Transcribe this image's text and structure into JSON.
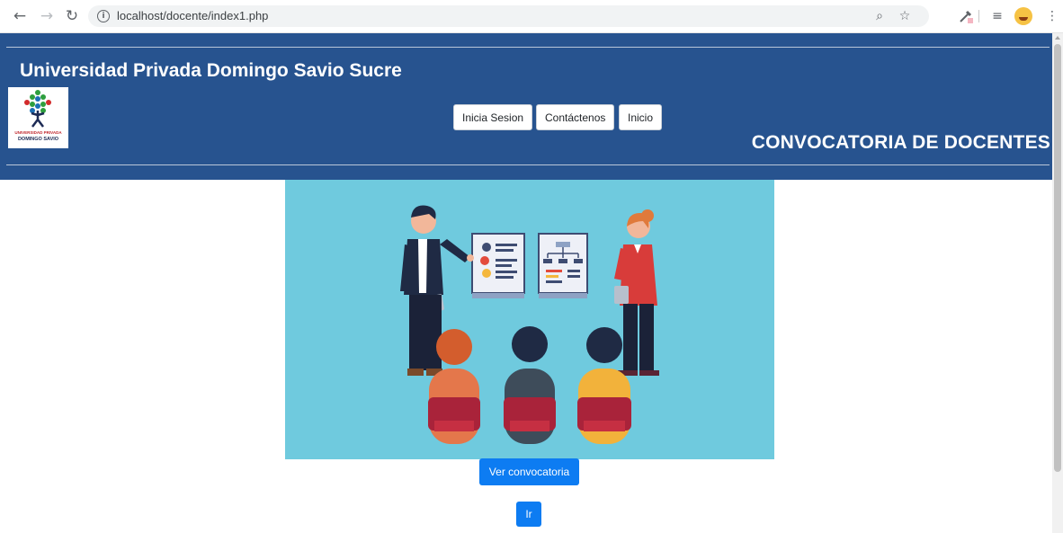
{
  "browser": {
    "back_icon": "arrow-left-icon",
    "forward_icon": "arrow-right-icon",
    "reload_icon": "reload-icon",
    "info_icon": "info-icon",
    "url": "localhost/docente/index1.php",
    "zoom_icon": "zoom-icon",
    "bookmark_icon": "star-icon",
    "extension_icons": [
      "eyedropper-icon",
      "media-icon",
      "profile-avatar-icon",
      "kebab-menu-icon"
    ]
  },
  "header": {
    "title": "Universidad Privada Domingo Savio Sucre",
    "logo": {
      "caption_line1": "UNIVERSIDAD PRIVADA",
      "caption_line2": "DOMINGO SAVIO"
    },
    "nav": [
      {
        "label": "Inicia Sesion"
      },
      {
        "label": "Contáctenos"
      },
      {
        "label": "Inicio"
      }
    ],
    "subtitle": "CONVOCATORIA DE DOCENTES"
  },
  "main": {
    "hero_image": "teacher-presentation-illustration",
    "primary_button": "Ver convocatoria",
    "go_button": "Ir"
  },
  "colors": {
    "header_bg": "#27538f",
    "hero_bg": "#6fcade",
    "primary": "#0d7cf2"
  }
}
